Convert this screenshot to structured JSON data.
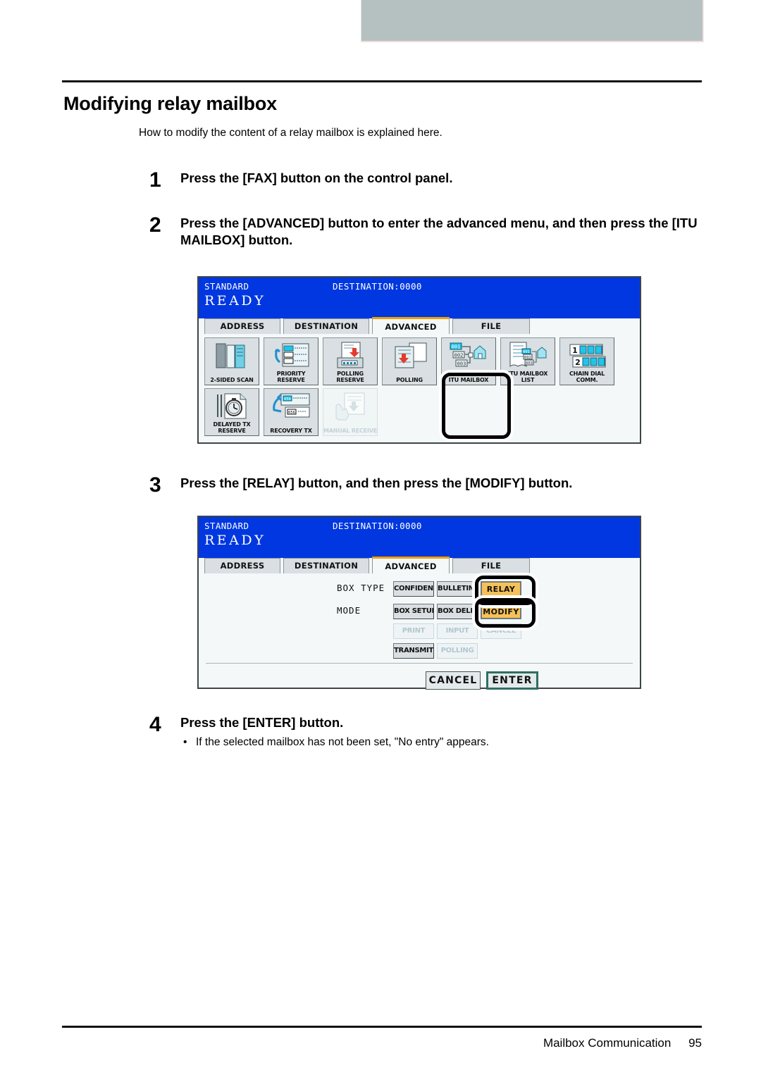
{
  "page": {
    "title": "Modifying relay mailbox",
    "intro": "How to modify the content of a relay mailbox is explained here.",
    "footer_title": "Mailbox Communication",
    "footer_page": "95",
    "banner_color": "#b5c1c0"
  },
  "steps": [
    {
      "num": "1",
      "text": "Press the [FAX] button on the control panel."
    },
    {
      "num": "2",
      "text": "Press the [ADVANCED] button to enter the advanced menu, and then press the [ITU MAILBOX] button."
    },
    {
      "num": "3",
      "text": "Press the [RELAY] button, and then press the [MODIFY] button."
    },
    {
      "num": "4",
      "text": "Press the [ENTER] button.",
      "note": "If the selected mailbox has not been set, \"No entry\" appears.",
      "bullet": "•"
    }
  ],
  "panel1": {
    "header": {
      "mode": "STANDARD",
      "destination": "DESTINATION:0000",
      "status": "READY"
    },
    "tabs": [
      {
        "label": "ADDRESS",
        "active": false
      },
      {
        "label": "DESTINATION",
        "active": false
      },
      {
        "label": "ADVANCED",
        "active": true
      },
      {
        "label": "FILE",
        "active": false
      }
    ],
    "icons": [
      {
        "label": "2-SIDED SCAN",
        "icon": "two-sided-scan-icon",
        "disabled": false,
        "highlighted": false
      },
      {
        "label": "PRIORITY RESERVE",
        "icon": "priority-reserve-icon",
        "disabled": false,
        "highlighted": false
      },
      {
        "label": "POLLING RESERVE",
        "icon": "polling-reserve-icon",
        "disabled": false,
        "highlighted": false
      },
      {
        "label": "POLLING",
        "icon": "polling-icon",
        "disabled": false,
        "highlighted": false
      },
      {
        "label": "ITU MAILBOX",
        "icon": "itu-mailbox-icon",
        "disabled": false,
        "highlighted": true
      },
      {
        "label": "ITU MAILBOX LIST",
        "icon": "itu-mailbox-list-icon",
        "disabled": false,
        "highlighted": false
      },
      {
        "label": "CHAIN DIAL COMM.",
        "icon": "chain-dial-comm-icon",
        "disabled": false,
        "highlighted": false
      },
      {
        "label": "DELAYED TX RESERVE",
        "icon": "delayed-tx-reserve-icon",
        "disabled": false,
        "highlighted": false
      },
      {
        "label": "RECOVERY TX",
        "icon": "recovery-tx-icon",
        "disabled": false,
        "highlighted": false
      },
      {
        "label": "MANUAL RECEIVE",
        "icon": "manual-receive-icon",
        "disabled": true,
        "highlighted": false
      }
    ]
  },
  "panel2": {
    "header": {
      "mode": "STANDARD",
      "destination": "DESTINATION:0000",
      "status": "READY"
    },
    "tabs": [
      {
        "label": "ADDRESS",
        "active": false
      },
      {
        "label": "DESTINATION",
        "active": false
      },
      {
        "label": "ADVANCED",
        "active": true
      },
      {
        "label": "FILE",
        "active": false
      }
    ],
    "labels": {
      "box_type": "BOX TYPE",
      "mode": "MODE"
    },
    "buttons": {
      "confidential": "CONFIDENTIAL",
      "bulletin_board": "BULLETIN B",
      "relay": "RELAY",
      "box_setup": "BOX SETUP",
      "box_delete": "BOX DELET",
      "modify": "MODIFY",
      "print": "PRINT",
      "input": "INPUT",
      "cancel_small": "CANCEL",
      "transmit": "TRANSMIT",
      "polling": "POLLING",
      "cancel": "CANCEL",
      "enter": "ENTER"
    },
    "selected_color": "#f5c158"
  }
}
